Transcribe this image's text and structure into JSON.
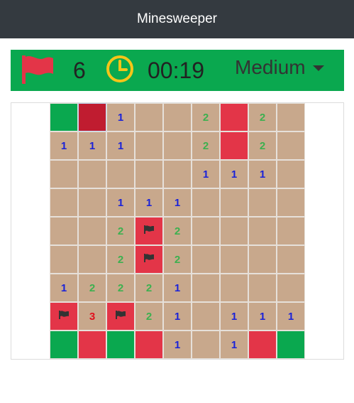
{
  "app": {
    "title": "Minesweeper"
  },
  "status_bar": {
    "flags_remaining": "6",
    "timer": "00:19",
    "difficulty": "Medium",
    "flag_icon": "flag-icon",
    "clock_icon": "clock-icon",
    "colors": {
      "bar": "#0aa84f",
      "flag": "#e33548",
      "clock": "#f5c518"
    }
  },
  "board": {
    "rows": 9,
    "cols": 9,
    "legend": {
      "o": "opened",
      "g": "unopened-green",
      "r": "unopened-red",
      "d": "unopened-selected",
      "f": "flagged"
    },
    "colors": {
      "opened": "#c8a88c",
      "green": "#0aa84f",
      "red": "#e33548",
      "selected": "#c01c30",
      "n1": "#1a22d8",
      "n2": "#3cb04f",
      "n3": "#e0101e"
    },
    "cells": [
      [
        "g",
        "d",
        "1",
        "o",
        "o",
        "2",
        "r",
        "2",
        "o"
      ],
      [
        "1",
        "1",
        "1",
        "o",
        "o",
        "2",
        "r",
        "2",
        "o"
      ],
      [
        "o",
        "o",
        "o",
        "o",
        "o",
        "1",
        "1",
        "1",
        "o"
      ],
      [
        "o",
        "o",
        "1",
        "1",
        "1",
        "o",
        "o",
        "o",
        "o"
      ],
      [
        "o",
        "o",
        "2",
        "f",
        "2",
        "o",
        "o",
        "o",
        "o"
      ],
      [
        "o",
        "o",
        "2",
        "f",
        "2",
        "o",
        "o",
        "o",
        "o"
      ],
      [
        "1",
        "2",
        "2",
        "2",
        "1",
        "o",
        "o",
        "o",
        "o"
      ],
      [
        "f",
        "3",
        "f",
        "2",
        "1",
        "o",
        "1",
        "1",
        "1"
      ],
      [
        "g",
        "r",
        "g",
        "r",
        "1",
        "o",
        "1",
        "r",
        "g"
      ]
    ]
  }
}
